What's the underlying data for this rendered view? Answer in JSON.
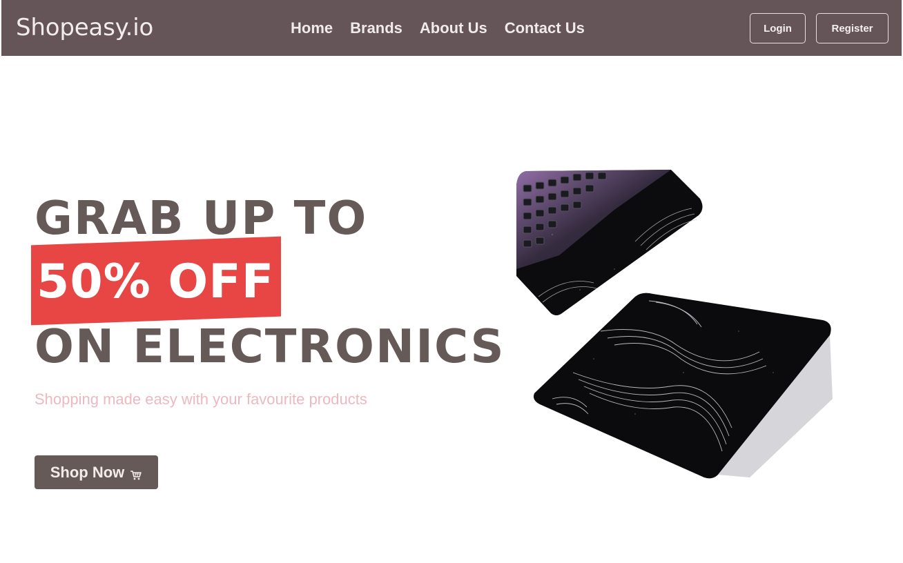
{
  "nav": {
    "brand": "Shopeasy.io",
    "links": [
      "Home",
      "Brands",
      "About Us",
      "Contact Us"
    ],
    "login_label": "Login",
    "register_label": "Register"
  },
  "hero": {
    "line1": "GRAB UP TO",
    "line2": "50% OFF",
    "line3": "ON ELECTRONICS",
    "tagline": "Shopping made easy with your favourite products",
    "cta_label": "Shop Now",
    "cta_icon": "cart-icon",
    "image": "laptop-with-black-contour-skin"
  },
  "colors": {
    "navbar": "#655559",
    "accent_red": "#e84545",
    "headline": "#655a58",
    "tagline": "#ecb9c0"
  }
}
